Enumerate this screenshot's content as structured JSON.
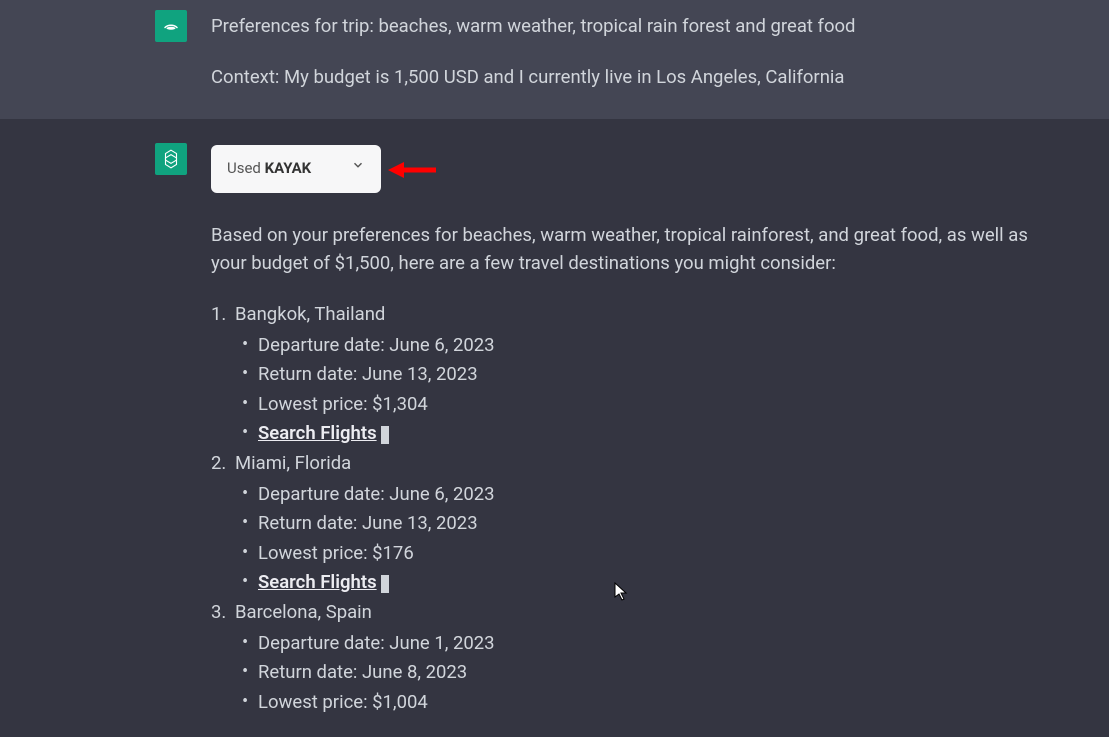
{
  "user": {
    "preferences_line": "Preferences for trip: beaches, warm weather, tropical rain forest and great food",
    "context_line": "Context: My budget is 1,500 USD and I currently live in Los Angeles, California"
  },
  "assistant": {
    "plugin_pill": {
      "prefix": "Used ",
      "name": "KAYAK"
    },
    "intro": "Based on your preferences for beaches, warm weather, tropical rainforest, and great food, as well as your budget of $1,500, here are a few travel destinations you might consider:",
    "destinations": [
      {
        "name": "Bangkok, Thailand",
        "departure": "Departure date: June 6, 2023",
        "return": "Return date: June 13, 2023",
        "price": "Lowest price: $1,304",
        "link": "Search Flights"
      },
      {
        "name": "Miami, Florida",
        "departure": "Departure date: June 6, 2023",
        "return": "Return date: June 13, 2023",
        "price": "Lowest price: $176",
        "link": "Search Flights"
      },
      {
        "name": "Barcelona, Spain",
        "departure": "Departure date: June 1, 2023",
        "return": "Return date: June 8, 2023",
        "price": "Lowest price: $1,004",
        "link": ""
      }
    ]
  }
}
